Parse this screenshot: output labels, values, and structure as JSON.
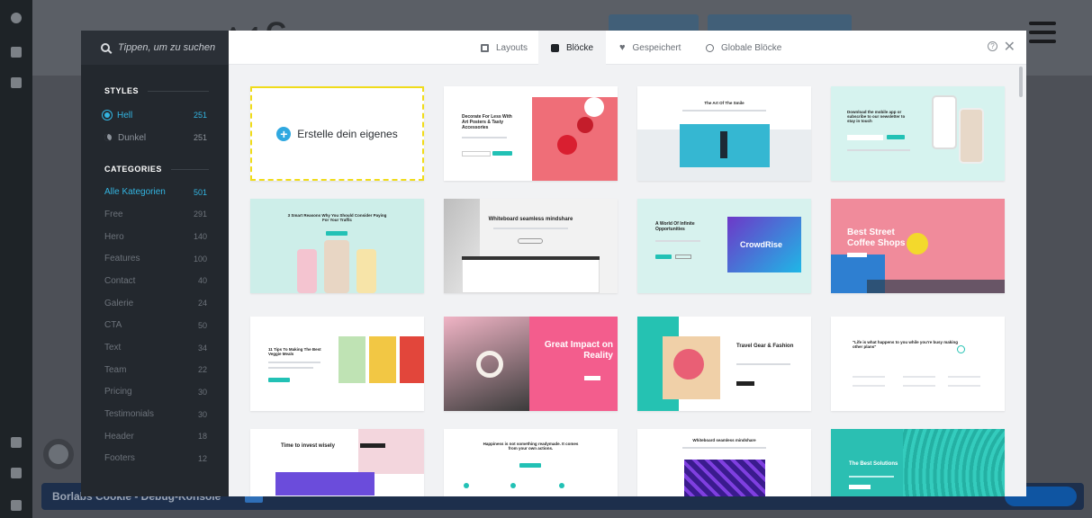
{
  "sidebar": {
    "search_placeholder": "Tippen, um zu suchen",
    "styles_title": "STYLES",
    "styles": [
      {
        "label": "Hell",
        "count": "251"
      },
      {
        "label": "Dunkel",
        "count": "251"
      }
    ],
    "categories_title": "CATEGORIES",
    "categories": [
      {
        "label": "Alle Kategorien",
        "count": "501"
      },
      {
        "label": "Free",
        "count": "291"
      },
      {
        "label": "Hero",
        "count": "140"
      },
      {
        "label": "Features",
        "count": "100"
      },
      {
        "label": "Contact",
        "count": "40"
      },
      {
        "label": "Galerie",
        "count": "24"
      },
      {
        "label": "CTA",
        "count": "50"
      },
      {
        "label": "Text",
        "count": "34"
      },
      {
        "label": "Team",
        "count": "22"
      },
      {
        "label": "Pricing",
        "count": "30"
      },
      {
        "label": "Testimonials",
        "count": "30"
      },
      {
        "label": "Header",
        "count": "18"
      },
      {
        "label": "Footers",
        "count": "12"
      }
    ]
  },
  "tabs": [
    {
      "label": "Layouts",
      "icon": "layout-icon"
    },
    {
      "label": "Blöcke",
      "icon": "block-icon"
    },
    {
      "label": "Gespeichert",
      "icon": "heart-icon"
    },
    {
      "label": "Globale Blöcke",
      "icon": "globe-icon"
    }
  ],
  "grid": {
    "create_label": "Erstelle dein eigenes",
    "cards": [
      {
        "title": "Decorate For Less With Art Posters & Tasty Accessories"
      },
      {
        "title": "The Art Of The Smile"
      },
      {
        "title": "Download the mobile app or subscribe to our newsletter to stay in touch"
      },
      {
        "title": "3 Smart Reasons Why You Should Consider Paying For Your Traffic"
      },
      {
        "title": "Whiteboard seamless mindshare"
      },
      {
        "title": "A World Of Infinite Opportunities",
        "extra": "CrowdRise"
      },
      {
        "title": "Best Street Coffee Shops"
      },
      {
        "title": "11 Tips To Making The Best Veggie Meals"
      },
      {
        "title": "Great Impact on Reality"
      },
      {
        "title": "Travel Gear & Fashion"
      },
      {
        "title": "\"Life is what happens to you while you're busy making other plans\""
      },
      {
        "title": "Time to invest wisely"
      },
      {
        "title": "Happiness is not something readymade. It comes from your own actions."
      },
      {
        "title": "Whiteboard seamless mindshare"
      },
      {
        "title": "The Best Solutions"
      }
    ]
  },
  "debug_bar": {
    "label": "Borlabs Cookie - Debug-Konsole"
  },
  "colors": {
    "accent": "#33b4e0",
    "create_border": "#f0dc1a",
    "teal": "#22c1b5"
  }
}
